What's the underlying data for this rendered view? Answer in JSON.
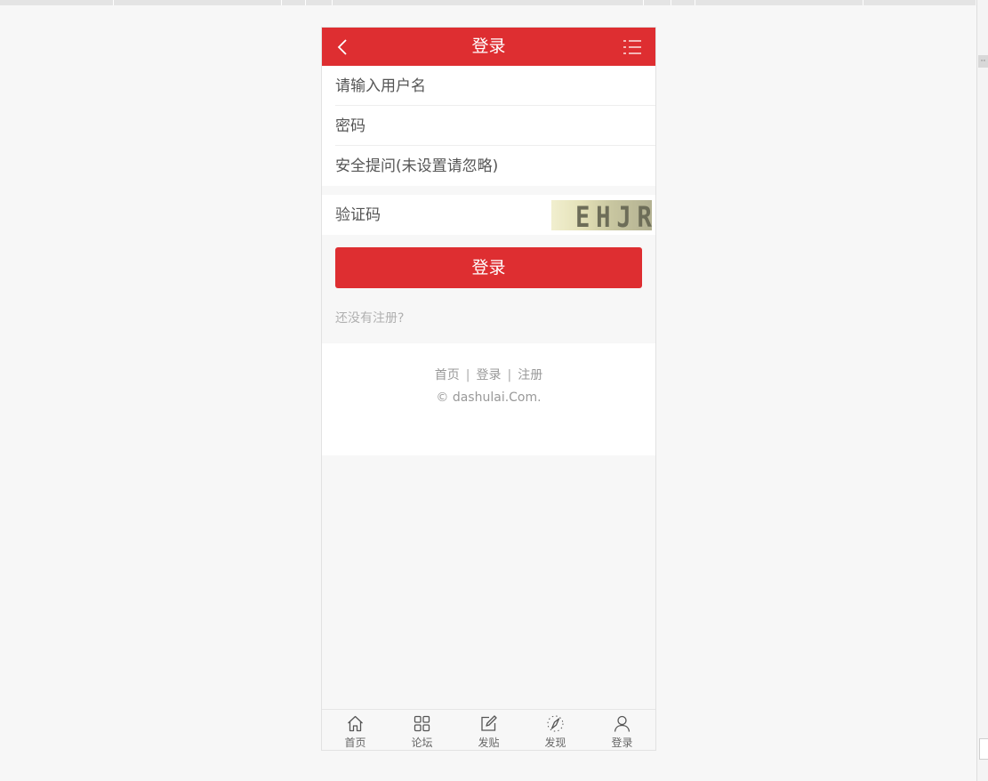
{
  "header": {
    "title": "登录"
  },
  "form": {
    "username_placeholder": "请输入用户名",
    "password_placeholder": "密码",
    "question_placeholder": "安全提问(未设置请忽略)",
    "captcha_placeholder": "验证码",
    "captcha_text": "EHJR",
    "submit_label": "登录",
    "register_link": "还没有注册?"
  },
  "footer": {
    "links": [
      "首页",
      "登录",
      "注册"
    ],
    "separator": "|",
    "copyright": "© dashulai.Com."
  },
  "tabbar": {
    "items": [
      {
        "label": "首页",
        "icon": "home-icon"
      },
      {
        "label": "论坛",
        "icon": "grid-icon"
      },
      {
        "label": "发贴",
        "icon": "edit-icon"
      },
      {
        "label": "发现",
        "icon": "compass-icon"
      },
      {
        "label": "登录",
        "icon": "user-icon"
      }
    ]
  },
  "colors": {
    "brand_red": "#de2e31",
    "page_bg": "#f7f7f7"
  }
}
